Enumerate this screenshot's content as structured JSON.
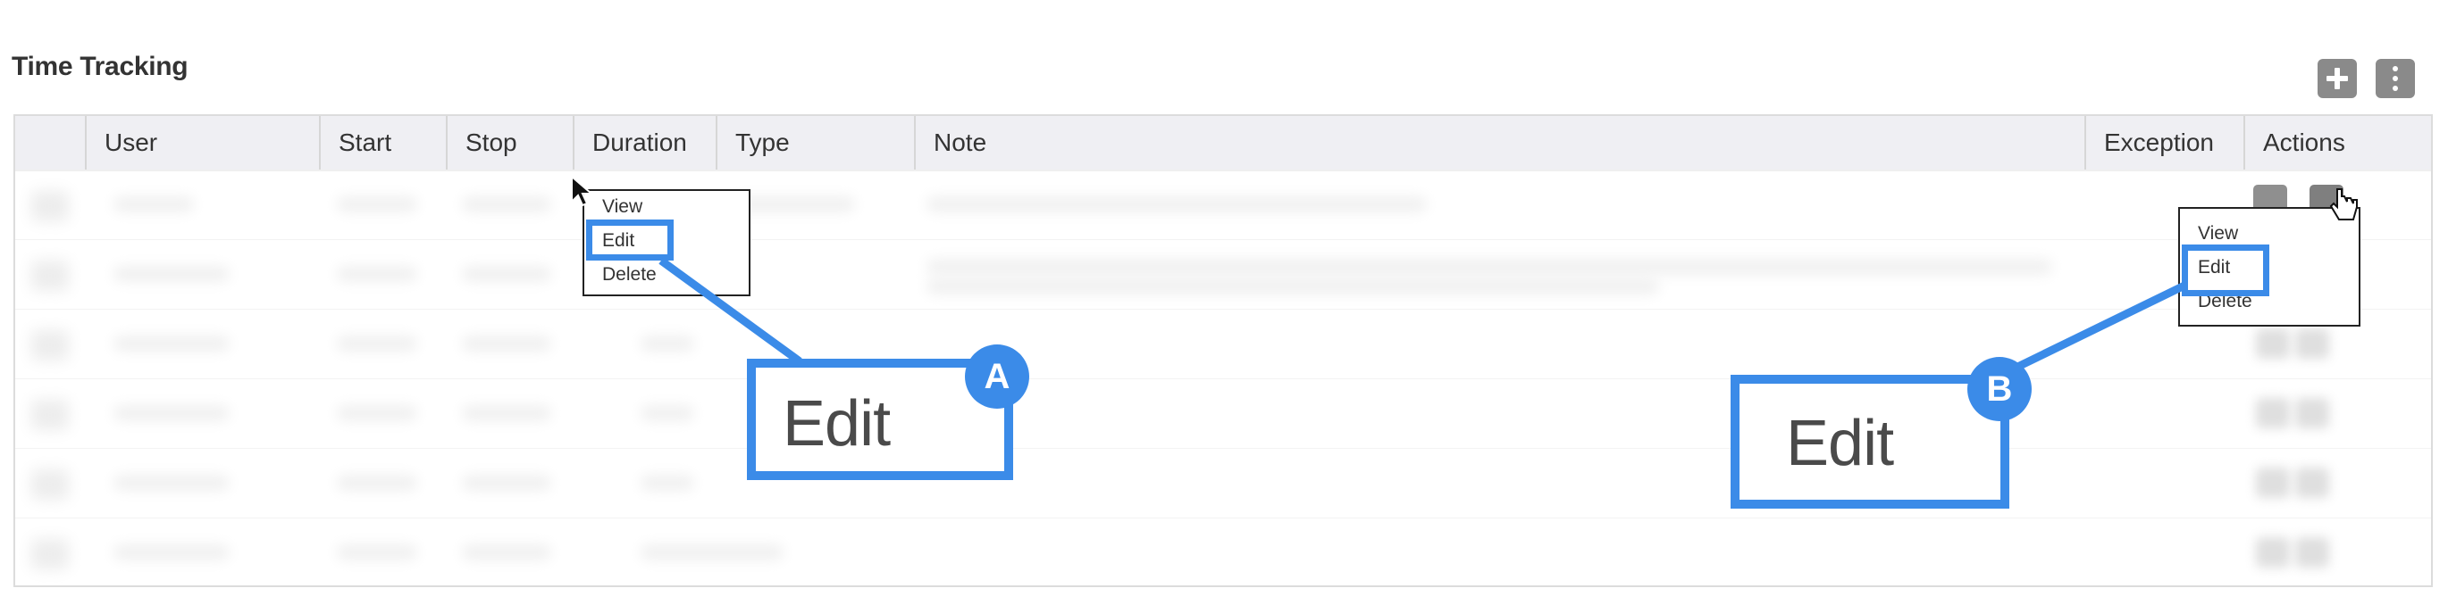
{
  "panel": {
    "title": "Time Tracking"
  },
  "toolbar": {
    "add_icon": "plus-icon",
    "more_icon": "kebab-icon"
  },
  "table": {
    "headers": [
      "",
      "User",
      "Start",
      "Stop",
      "Duration",
      "Type",
      "Note",
      "Exception",
      "Actions"
    ]
  },
  "context_menu_a": {
    "items": [
      "View",
      "Edit",
      "Delete"
    ]
  },
  "context_menu_b": {
    "items": [
      "View",
      "Edit",
      "Delete"
    ]
  },
  "callout_a": {
    "label": "A",
    "text": "Edit"
  },
  "callout_b": {
    "label": "B",
    "text": "Edit"
  },
  "colors": {
    "accent": "#3b8be8",
    "header_bg": "#efeff3",
    "button_gray": "#8a8a8a"
  }
}
